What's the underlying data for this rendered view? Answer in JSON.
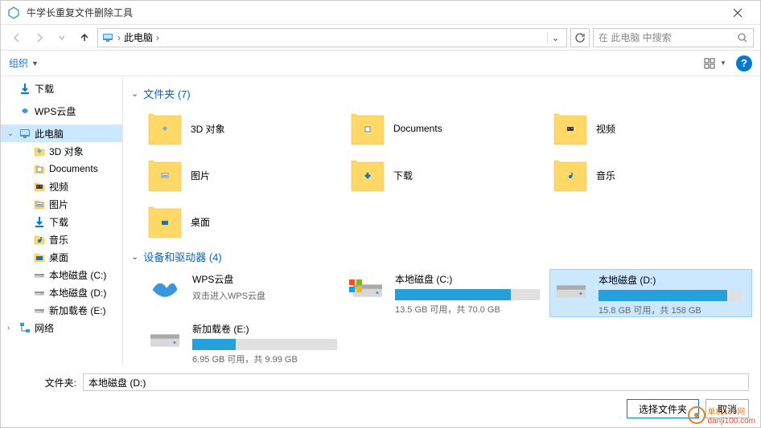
{
  "window": {
    "title": "牛学长重复文件删除工具"
  },
  "nav": {
    "location": "此电脑",
    "search_placeholder": "在 此电脑 中搜索"
  },
  "toolbar": {
    "organize": "组织"
  },
  "sidebar": {
    "items": [
      {
        "label": "下载",
        "icon": "download"
      },
      {
        "label": "WPS云盘",
        "icon": "wps"
      },
      {
        "label": "此电脑",
        "icon": "pc",
        "selected": true
      },
      {
        "label": "3D 对象",
        "icon": "3d",
        "indent": true
      },
      {
        "label": "Documents",
        "icon": "doc",
        "indent": true
      },
      {
        "label": "视频",
        "icon": "video",
        "indent": true
      },
      {
        "label": "图片",
        "icon": "image",
        "indent": true
      },
      {
        "label": "下载",
        "icon": "download",
        "indent": true
      },
      {
        "label": "音乐",
        "icon": "music",
        "indent": true
      },
      {
        "label": "桌面",
        "icon": "desktop",
        "indent": true
      },
      {
        "label": "本地磁盘 (C:)",
        "icon": "drive",
        "indent": true
      },
      {
        "label": "本地磁盘 (D:)",
        "icon": "drive",
        "indent": true
      },
      {
        "label": "新加载卷 (E:)",
        "icon": "drive",
        "indent": true
      },
      {
        "label": "网络",
        "icon": "network"
      }
    ]
  },
  "content": {
    "folders_header": "文件夹 (7)",
    "devices_header": "设备和驱动器 (4)",
    "folders": [
      {
        "name": "3D 对象",
        "icon": "3d"
      },
      {
        "name": "Documents",
        "icon": "doc"
      },
      {
        "name": "视频",
        "icon": "video"
      },
      {
        "name": "图片",
        "icon": "image"
      },
      {
        "name": "下载",
        "icon": "download-big"
      },
      {
        "name": "音乐",
        "icon": "music"
      },
      {
        "name": "桌面",
        "icon": "desktop"
      }
    ],
    "devices": [
      {
        "name": "WPS云盘",
        "sub": "双击进入WPS云盘",
        "icon": "wps-big",
        "type": "cloud"
      },
      {
        "name": "本地磁盘 (C:)",
        "stats": "13.5 GB 可用，共 70.0 GB",
        "fill": 80,
        "icon": "drive-big",
        "type": "drive",
        "os": true
      },
      {
        "name": "本地磁盘 (D:)",
        "stats": "15.8 GB 可用，共 158 GB",
        "fill": 90,
        "icon": "drive-big",
        "type": "drive",
        "selected": true
      },
      {
        "name": "新加载卷 (E:)",
        "stats": "6.95 GB 可用，共 9.99 GB",
        "fill": 30,
        "icon": "drive-big",
        "type": "drive"
      }
    ]
  },
  "footer": {
    "label": "文件夹:",
    "value": "本地磁盘 (D:)",
    "select_btn": "选择文件夹",
    "cancel_btn": "取消"
  },
  "watermark": {
    "text": "单机100网",
    "url": "danji100.com"
  }
}
